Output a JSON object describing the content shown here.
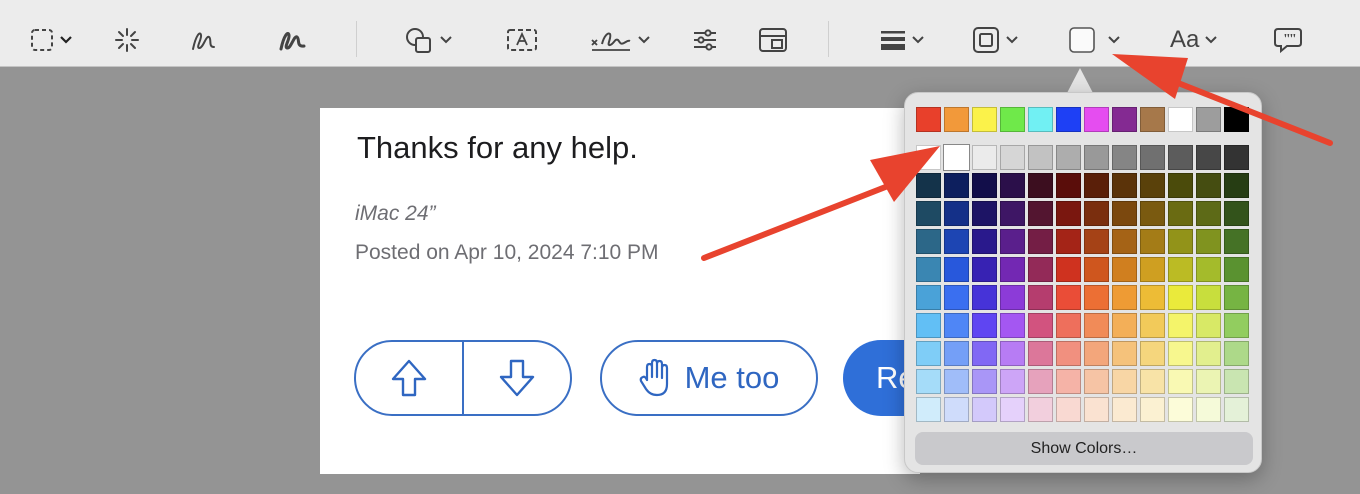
{
  "toolbar": {
    "tools": [
      {
        "name": "selection-tool",
        "icon": "dashed-rect-icon",
        "has_menu": true
      },
      {
        "name": "instant-alpha-tool",
        "icon": "magic-wand-icon",
        "has_menu": false
      },
      {
        "name": "sketch-tool",
        "icon": "sketch-icon",
        "has_menu": false
      },
      {
        "name": "draw-tool",
        "icon": "draw-icon",
        "has_menu": false
      },
      {
        "name": "shapes-tool",
        "icon": "shapes-icon",
        "has_menu": true
      },
      {
        "name": "text-tool",
        "icon": "text-box-icon",
        "has_menu": false
      },
      {
        "name": "sign-tool",
        "icon": "signature-icon",
        "has_menu": true
      },
      {
        "name": "adjust-color-tool",
        "icon": "sliders-icon",
        "has_menu": false
      },
      {
        "name": "adjust-size-tool",
        "icon": "resize-icon",
        "has_menu": false
      },
      {
        "name": "shape-style-tool",
        "icon": "line-weight-icon",
        "has_menu": true
      },
      {
        "name": "border-color-tool",
        "icon": "border-color-icon",
        "has_menu": true
      },
      {
        "name": "fill-color-tool",
        "icon": "fill-color-icon",
        "has_menu": true
      },
      {
        "name": "text-style-tool",
        "label": "Aa",
        "has_menu": true
      },
      {
        "name": "annotate-tool",
        "icon": "speech-bubble-icon",
        "has_menu": false
      }
    ]
  },
  "post": {
    "thanks": "Thanks for any help.",
    "device": "iMac 24”",
    "posted": "Posted on Apr 10, 2024 7:10 PM",
    "me_too_label": "Me too",
    "reply_label": "Re"
  },
  "color_popover": {
    "show_colors_label": "Show Colors…",
    "top_row": [
      "#e8402b",
      "#f2993a",
      "#fbf24a",
      "#6fe94a",
      "#71f0f3",
      "#1e40f5",
      "#e54df0",
      "#842a92",
      "#a6784a",
      "#ffffff",
      "#9d9d9d",
      "#000000"
    ],
    "grid": [
      [
        "#ffffff",
        "#ffffff",
        "#ebebeb",
        "#d6d6d6",
        "#c2c2c2",
        "#adadad",
        "#999999",
        "#858585",
        "#707070",
        "#5c5c5c",
        "#474747",
        "#333333"
      ],
      [
        "#14334a",
        "#0d1f5e",
        "#120e4a",
        "#2b0f4a",
        "#3c0e1f",
        "#5a0d0a",
        "#5a1f09",
        "#5b3309",
        "#5a410a",
        "#4b4b0b",
        "#454d11",
        "#263d13"
      ],
      [
        "#1e4a63",
        "#143088",
        "#1d1465",
        "#3e1665",
        "#531530",
        "#7a170f",
        "#7a2e0e",
        "#7b480e",
        "#7a5a10",
        "#6a6b12",
        "#5d6a17",
        "#33531b"
      ],
      [
        "#2c6788",
        "#1d45b3",
        "#29198c",
        "#5a1f8c",
        "#741e45",
        "#a42417",
        "#a54216",
        "#a56316",
        "#a47c17",
        "#929319",
        "#80931f",
        "#457226"
      ],
      [
        "#3a86b2",
        "#2858dc",
        "#3722b3",
        "#7328b3",
        "#932a58",
        "#cf321f",
        "#cf561e",
        "#d07f1f",
        "#cf9f21",
        "#bbbb24",
        "#a4bb2b",
        "#5a9230"
      ],
      [
        "#4aa2d8",
        "#3a6ff0",
        "#4633d8",
        "#8c3bd8",
        "#b53d6e",
        "#ea4d37",
        "#ec6f34",
        "#ee9b34",
        "#edbc36",
        "#eaea3b",
        "#c8de3d",
        "#76b443"
      ],
      [
        "#62bff5",
        "#4f86f6",
        "#5f45f2",
        "#a457f2",
        "#d2537f",
        "#ee6f5c",
        "#f18b58",
        "#f3af58",
        "#f2ca5a",
        "#f4f46a",
        "#d8e966",
        "#92cd5f"
      ],
      [
        "#7fcdf7",
        "#749ff7",
        "#8168f4",
        "#b77cf4",
        "#dc779a",
        "#f1907f",
        "#f3a67b",
        "#f5c27b",
        "#f5d67d",
        "#f7f78e",
        "#e2ef8e",
        "#add989"
      ],
      [
        "#a5dcf9",
        "#a0bdf9",
        "#a996f7",
        "#cda5f7",
        "#e6a2bc",
        "#f5b3a7",
        "#f6c4a5",
        "#f8d6a5",
        "#f8e3a7",
        "#f9f9b3",
        "#ebf4b3",
        "#c9e5b1"
      ],
      [
        "#d0ecfb",
        "#cfdcfb",
        "#d3c9fb",
        "#e5d1fb",
        "#f2cfdd",
        "#f9d9d2",
        "#fae2d1",
        "#fbead1",
        "#fbf1d2",
        "#fcfcd9",
        "#f5fad9",
        "#e4f1d8"
      ]
    ]
  },
  "annotation_color": "#e8432e"
}
